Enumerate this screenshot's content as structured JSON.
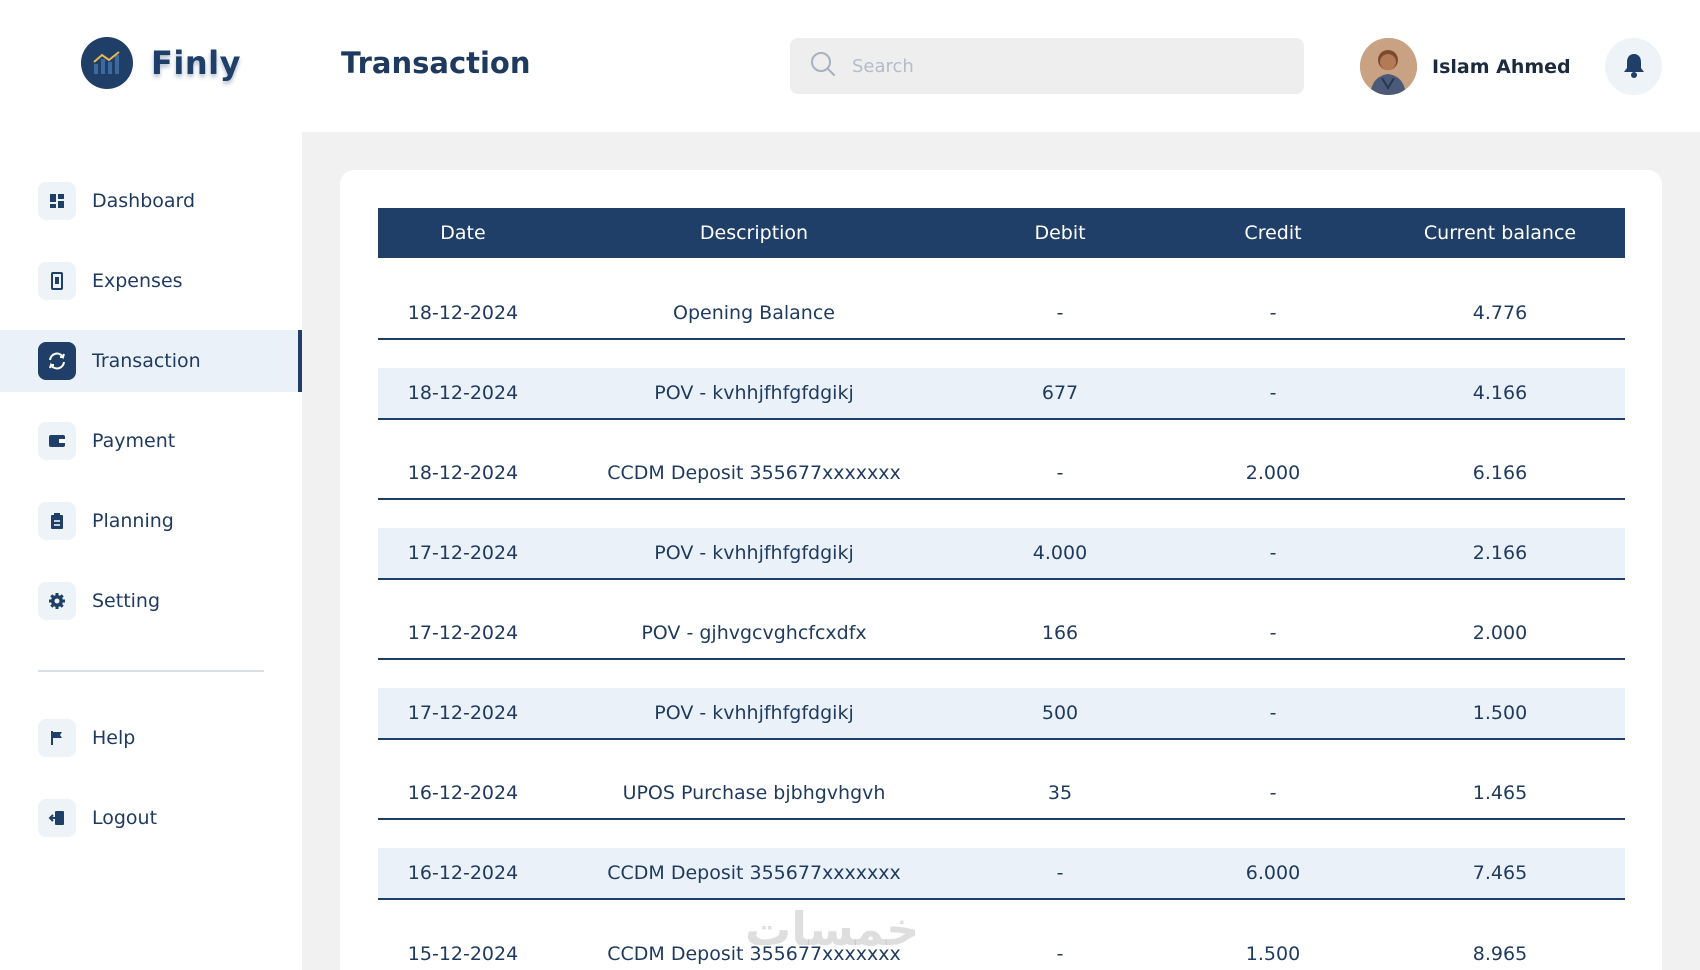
{
  "brand": {
    "name": "Finly",
    "accent": "#1f3f68"
  },
  "header": {
    "title": "Transaction",
    "search_placeholder": "Search",
    "user_name": "Islam Ahmed"
  },
  "sidebar": {
    "items": [
      {
        "label": "Dashboard",
        "icon": "dashboard-icon"
      },
      {
        "label": "Expenses",
        "icon": "receipt-icon"
      },
      {
        "label": "Transaction",
        "icon": "exchange-icon"
      },
      {
        "label": "Payment",
        "icon": "wallet-icon"
      },
      {
        "label": "Planning",
        "icon": "clipboard-icon"
      },
      {
        "label": "Setting",
        "icon": "gear-icon"
      }
    ],
    "bottom_items": [
      {
        "label": "Help",
        "icon": "flag-icon"
      },
      {
        "label": "Logout",
        "icon": "logout-icon"
      }
    ],
    "active": "Transaction"
  },
  "table": {
    "columns": [
      "Date",
      "Description",
      "Debit",
      "Credit",
      "Current balance"
    ],
    "rows": [
      [
        "18-12-2024",
        "Opening Balance",
        "-",
        "-",
        "4.776"
      ],
      [
        "18-12-2024",
        "POV - kvhhjfhfgfdgikj",
        "677",
        "-",
        "4.166"
      ],
      [
        "18-12-2024",
        "CCDM Deposit 355677xxxxxxx",
        "-",
        "2.000",
        "6.166"
      ],
      [
        "17-12-2024",
        "POV - kvhhjfhfgfdgikj",
        "4.000",
        "-",
        "2.166"
      ],
      [
        "17-12-2024",
        "POV - gjhvgcvghcfcxdfx",
        "166",
        "-",
        "2.000"
      ],
      [
        "17-12-2024",
        "POV - kvhhjfhfgfdgikj",
        "500",
        "-",
        "1.500"
      ],
      [
        "16-12-2024",
        "UPOS Purchase bjbhgvhgvh",
        "35",
        "-",
        "1.465"
      ],
      [
        "16-12-2024",
        "CCDM Deposit 355677xxxxxxx",
        "-",
        "6.000",
        "7.465"
      ],
      [
        "15-12-2024",
        "CCDM Deposit 355677xxxxxxx",
        "-",
        "1.500",
        "8.965"
      ]
    ]
  },
  "watermark": "خمسات"
}
